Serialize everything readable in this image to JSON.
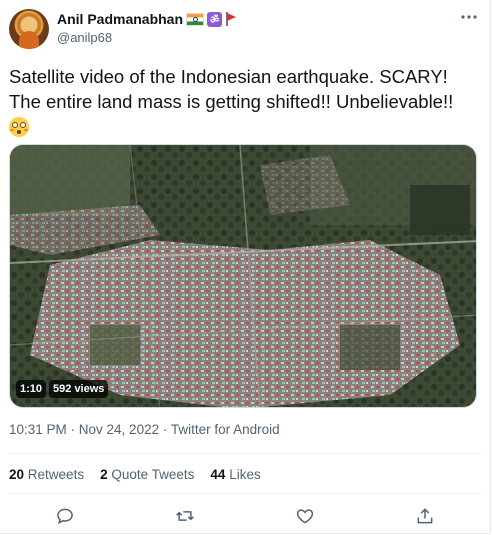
{
  "user": {
    "display_name": "Anil Padmanabhan",
    "handle": "@anilp68",
    "name_badges": [
      "india-flag-icon",
      "om-icon",
      "saffron-flag-icon"
    ]
  },
  "tweet": {
    "text_line1": "Satellite video of the Indonesian earthquake. SCARY!",
    "text_line2": "The entire land mass is getting shifted!! Unbelievable!!",
    "emoji": "flushed-face-icon"
  },
  "media": {
    "duration": "1:10",
    "views": "592 views"
  },
  "meta": {
    "timestamp": "10:31 PM · Nov 24, 2022 · Twitter for Android"
  },
  "stats": {
    "retweets_count": "20",
    "retweets_label": "Retweets",
    "quotes_count": "2",
    "quotes_label": "Quote Tweets",
    "likes_count": "44",
    "likes_label": "Likes"
  },
  "actions": [
    "reply-icon",
    "retweet-icon",
    "like-icon",
    "share-icon"
  ],
  "colors": {
    "text": "#0f1419",
    "secondary": "#536471",
    "divider": "#eff3f4"
  }
}
